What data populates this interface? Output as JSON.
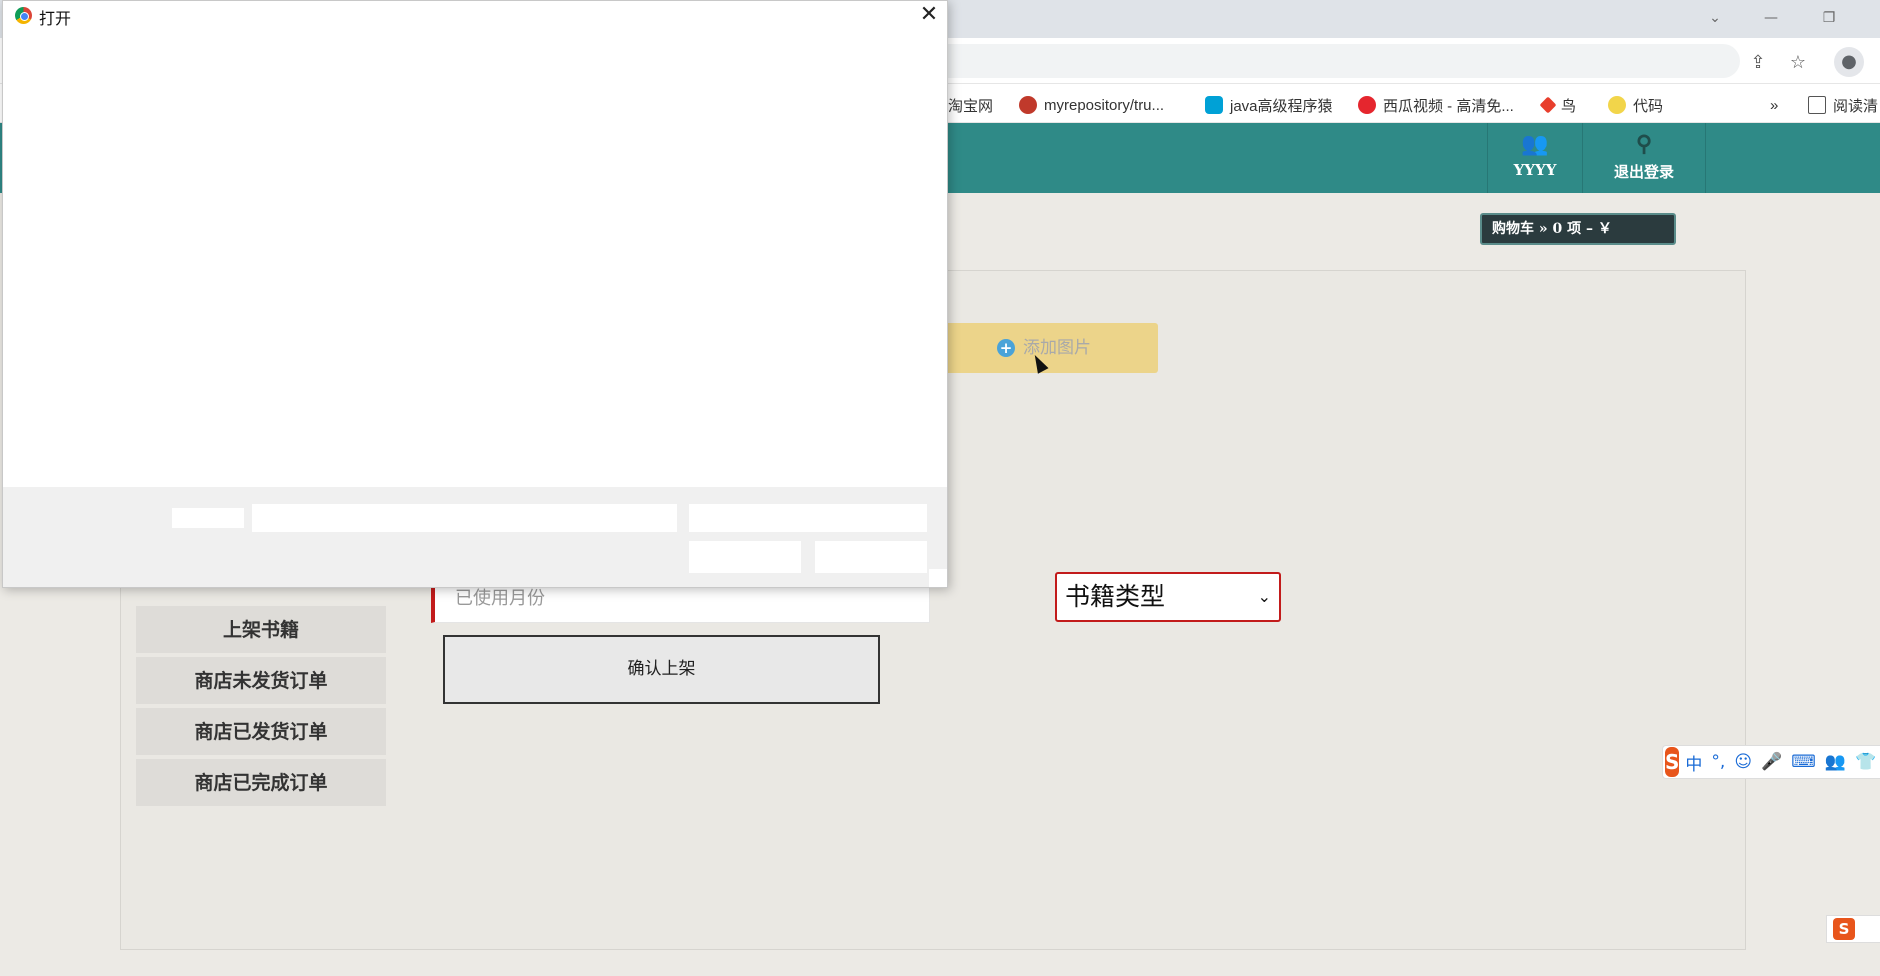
{
  "browser": {
    "window_controls": {
      "dropdown": "⌄",
      "minimize": "—",
      "restore": "❐"
    },
    "bookmarks": [
      {
        "label": "淘宝网",
        "icon_color": "#ff5000"
      },
      {
        "label": "myrepository/tru...",
        "icon_color": "#c0392b"
      },
      {
        "label": "java高级程序猿",
        "icon_color": "#00a1d6"
      },
      {
        "label": "西瓜视频 - 高清免...",
        "icon_color": "#e5262e"
      },
      {
        "label": "鸟",
        "icon_color": "#e83e2c"
      },
      {
        "label": "代码",
        "icon_color": "#f2d54a"
      },
      {
        "label": "»",
        "icon_color": ""
      },
      {
        "label": "阅读清",
        "icon_color": ""
      }
    ]
  },
  "header": {
    "user_label": "YYYY",
    "logout_label": "退出登录",
    "cart_label": "购物车  » 0 项 – ￥"
  },
  "sidebar": {
    "items": [
      {
        "label": "上架书籍"
      },
      {
        "label": "商店未发货订单"
      },
      {
        "label": "商店已发货订单"
      },
      {
        "label": "商店已完成订单"
      }
    ]
  },
  "form": {
    "add_image_label": "添加图片",
    "month_placeholder": "已使用月份",
    "confirm_label": "确认上架",
    "book_type_selected": "书籍类型"
  },
  "dialog": {
    "title": "打开",
    "close": "✕"
  },
  "ime": {
    "logo": "S",
    "mode": "中",
    "punct": "°,",
    "items": [
      "☺",
      "🎤",
      "⌨",
      "👥",
      "👕"
    ]
  }
}
